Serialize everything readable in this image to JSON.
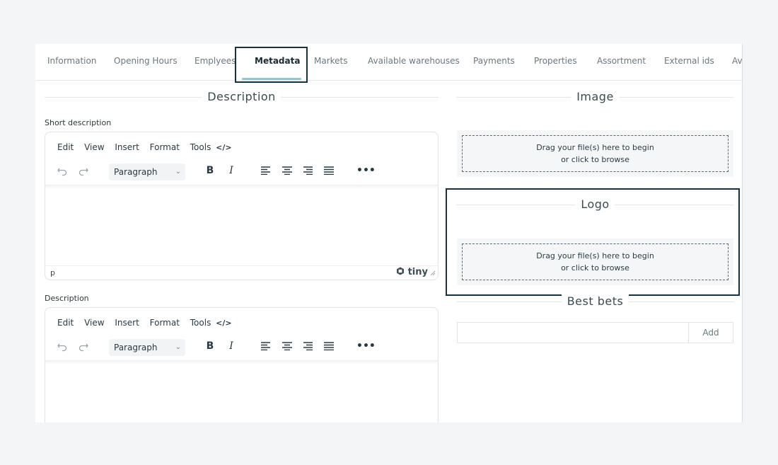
{
  "tabs": [
    "Information",
    "Opening Hours",
    "Emplyees",
    "Metadata",
    "Markets",
    "Available warehouses",
    "Payments",
    "Properties",
    "Assortment",
    "External ids",
    "Av"
  ],
  "active_tab": "Metadata",
  "description_section": {
    "title": "Description",
    "short_description_label": "Short description",
    "description_label": "Description"
  },
  "editor": {
    "menu": [
      "Edit",
      "View",
      "Insert",
      "Format",
      "Tools"
    ],
    "code_glyph": "</>",
    "block_format": "Paragraph",
    "status_path": "p",
    "brand": "tiny"
  },
  "image_section": {
    "title": "Image",
    "drop_line1": "Drag your file(s) here to begin",
    "drop_line2": "or click to browse"
  },
  "logo_section": {
    "title": "Logo",
    "drop_line1": "Drag your file(s) here to begin",
    "drop_line2": "or click to browse"
  },
  "best_bets": {
    "title": "Best bets",
    "input_value": "",
    "add_label": "Add"
  },
  "icons": {
    "undo": "undo-icon",
    "redo": "redo-icon",
    "bold": "bold-icon",
    "italic": "italic-icon",
    "align_left": "align-left-icon",
    "align_center": "align-center-icon",
    "align_right": "align-right-icon",
    "justify": "justify-icon",
    "more": "more-icon",
    "code": "code-icon",
    "tiny_logo": "tiny-logo-icon",
    "resize": "resize-handle-icon",
    "chevron": "chevron-down-icon"
  },
  "colors": {
    "accent_underline": "#8fc7d1",
    "focus_border": "#16323d"
  }
}
